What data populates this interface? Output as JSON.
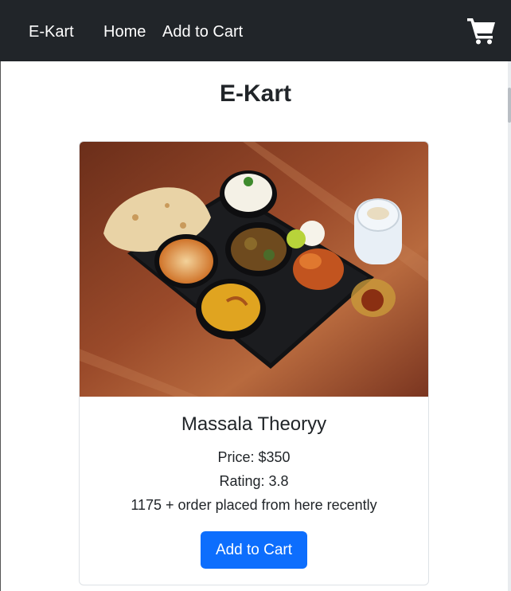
{
  "navbar": {
    "brand": "E-Kart",
    "links": [
      {
        "label": "Home"
      },
      {
        "label": "Add to Cart"
      }
    ],
    "cart_icon": "shopping-cart-icon"
  },
  "page": {
    "title": "E-Kart"
  },
  "card": {
    "image_alt": "thali-food-image",
    "name": "Massala Theoryy",
    "price": "Price: $350",
    "rating": "Rating: 3.8",
    "orders": "1175 + order placed from here recently",
    "button_label": "Add to Cart"
  },
  "colors": {
    "navbar_bg": "#212529",
    "primary": "#0d6efd"
  }
}
